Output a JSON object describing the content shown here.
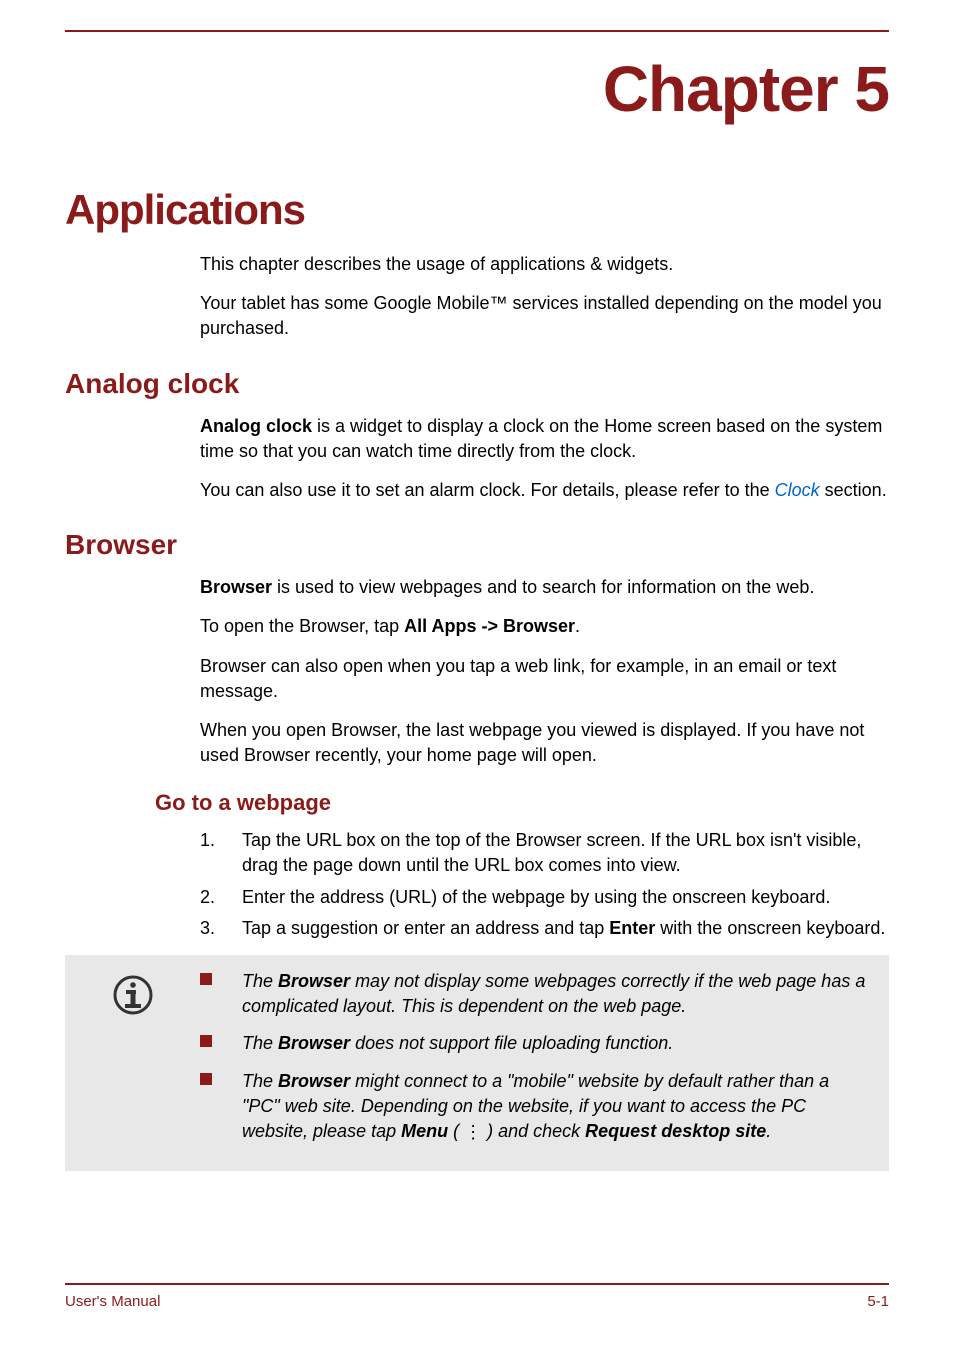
{
  "chapter_label": "Chapter 5",
  "h1": "Applications",
  "intro": {
    "p1": "This chapter describes the usage of applications & widgets.",
    "p2": "Your tablet has some Google Mobile™ services installed depending on the model you purchased."
  },
  "analog_clock": {
    "heading": "Analog clock",
    "p1_bold": "Analog clock",
    "p1_rest": " is a widget to display a clock on the Home screen based on the system time so that you can watch time directly from the clock.",
    "p2_before": "You can also use it to set an alarm clock. For details, please refer to the ",
    "p2_link": "Clock",
    "p2_after": " section."
  },
  "browser": {
    "heading": "Browser",
    "p1_bold": "Browser",
    "p1_rest": " is used to view webpages and to search for information on the web.",
    "p2_before": "To open the Browser, tap ",
    "p2_bold": "All Apps -> Browser",
    "p2_after": ".",
    "p3": "Browser can also open when you tap a web link, for example, in an email or text message.",
    "p4": "When you open Browser, the last webpage you viewed is displayed. If you have not used Browser recently, your home page will open."
  },
  "go_to_webpage": {
    "heading": "Go to a webpage",
    "steps": [
      {
        "num": "1.",
        "text": "Tap the URL box on the top of the Browser screen. If the URL box isn't visible, drag the page down until the URL box comes into view."
      },
      {
        "num": "2.",
        "text": "Enter the address (URL) of the webpage by using the onscreen keyboard."
      },
      {
        "num": "3.",
        "before": "Tap a suggestion or enter an address and tap ",
        "bold": "Enter",
        "after": " with the onscreen keyboard."
      }
    ]
  },
  "notes": {
    "n1_before": "The ",
    "n1_bold": "Browser",
    "n1_after": " may not display some webpages correctly if the web page has a complicated layout. This is dependent on the web page.",
    "n2_before": "The ",
    "n2_bold": "Browser",
    "n2_after": " does not support file uploading function.",
    "n3_before": "The ",
    "n3_bold1": "Browser",
    "n3_mid1": " might connect to a \"mobile\" website by default rather than a \"PC\" web site. Depending on the website, if you want to access the PC website, please tap ",
    "n3_bold2": "Menu",
    "n3_mid2": " ( ",
    "n3_icon": "⋮",
    "n3_mid3": " ) and check ",
    "n3_bold3": "Request desktop site",
    "n3_after": "."
  },
  "footer": {
    "left": "User's Manual",
    "right": "5-1"
  }
}
